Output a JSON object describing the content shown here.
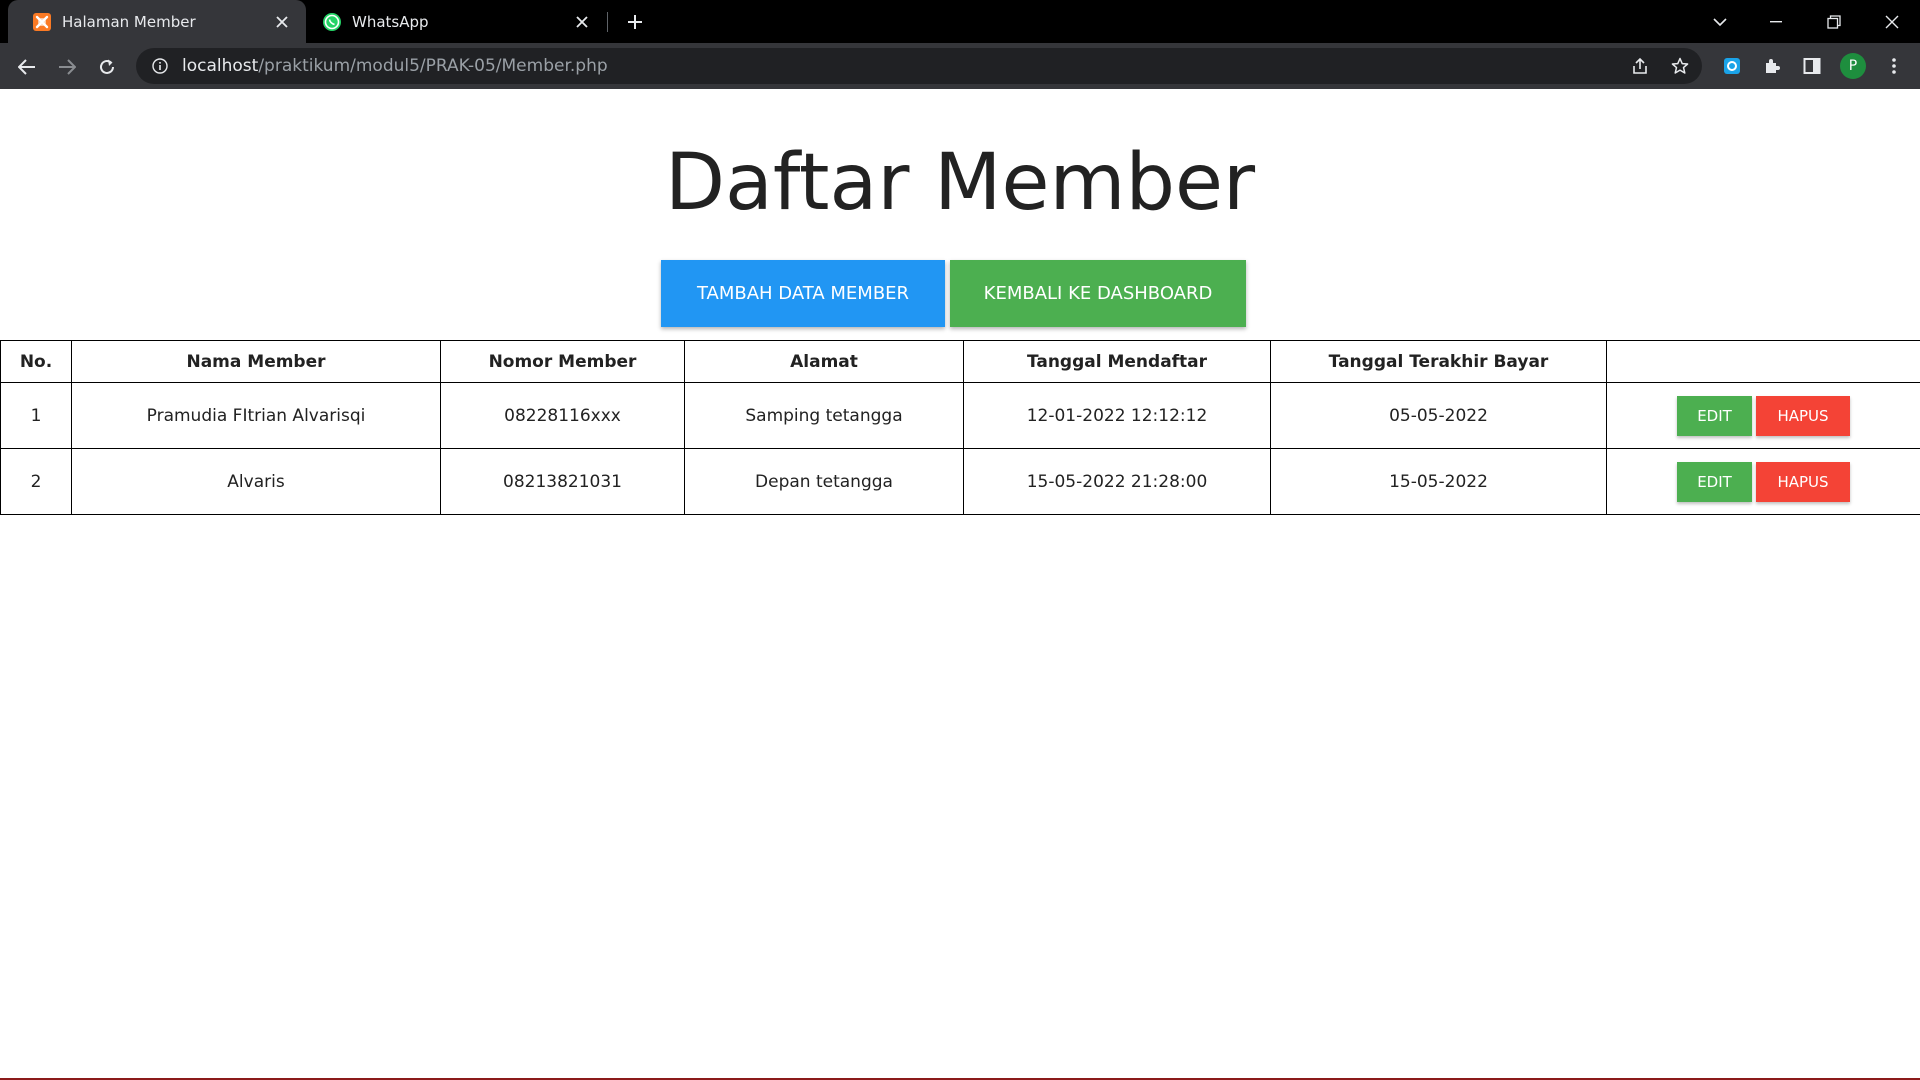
{
  "browser": {
    "tabs": [
      {
        "title": "Halaman Member",
        "active": true,
        "icon": "xampp-icon"
      },
      {
        "title": "WhatsApp",
        "active": false,
        "icon": "whatsapp-icon"
      }
    ],
    "url_host": "localhost",
    "url_path": "/praktikum/modul5/PRAK-05/Member.php",
    "profile_initial": "P"
  },
  "page": {
    "title": "Daftar Member",
    "add_button": "TAMBAH DATA MEMBER",
    "dashboard_button": "KEMBALI KE DASHBOARD"
  },
  "table": {
    "headers": [
      "No.",
      "Nama Member",
      "Nomor Member",
      "Alamat",
      "Tanggal Mendaftar",
      "Tanggal Terakhir Bayar",
      ""
    ],
    "rows": [
      {
        "no": "1",
        "nama": "Pramudia FItrian Alvarisqi",
        "nomor": "08228116xxx",
        "alamat": "Samping tetangga",
        "tgl_daftar": "12-01-2022 12:12:12",
        "tgl_bayar": "05-05-2022"
      },
      {
        "no": "2",
        "nama": "Alvaris",
        "nomor": "08213821031",
        "alamat": "Depan tetangga",
        "tgl_daftar": "15-05-2022 21:28:00",
        "tgl_bayar": "15-05-2022"
      }
    ],
    "edit_label": "EDIT",
    "delete_label": "HAPUS"
  },
  "colors": {
    "blue": "#2196f3",
    "green": "#4caf50",
    "red": "#f44336"
  }
}
